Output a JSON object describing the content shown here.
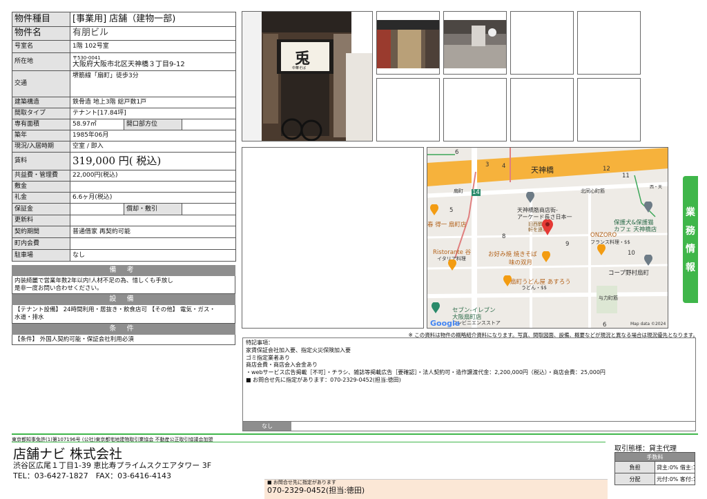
{
  "spec": {
    "type_label": "物件種目",
    "type_value": "[事業用] 店舗（建物一部)",
    "name_label": "物件名",
    "name_value": "有朋ビル",
    "room_label": "号室名",
    "room_value": "1階 102号室",
    "address_label": "所在地",
    "postal": "〒530-0041",
    "address": "大阪府大阪市北区天神橋３丁目9-12",
    "transport_label": "交通",
    "transport": "堺筋線「扇町」徒歩3分",
    "structure_label": "建築構造",
    "structure": "鉄骨造 地上3階 総戸数1戸",
    "layout_label": "間取タイプ",
    "layout": "テナント[17.84坪]",
    "area_label": "専有面積",
    "area": "58.97㎡",
    "opening_label": "開口部方位",
    "opening": "",
    "built_label": "築年",
    "built": "1985年06月",
    "status_label": "現況/入居時期",
    "status": "空室 / 即入",
    "rent_label": "賃料",
    "rent": "319,000 円( 税込)",
    "fee_label": "共益費・管理費",
    "fee": "22,000円(税込)",
    "shikikin_label": "敷金",
    "shikikin": "",
    "reikin_label": "礼金",
    "reikin": "6.6ヶ月(税込)",
    "deposit_label": "保証金",
    "deposit": "",
    "amort_label": "償却・敷引",
    "amort": "",
    "renewal_label": "更新料",
    "renewal": "",
    "contract_label": "契約期間",
    "contract": "普通借家 再契約可能",
    "town_label": "町内会費",
    "town": "",
    "parking_label": "駐車場",
    "parking": "なし"
  },
  "remarks": {
    "title": "備 考",
    "text1": "内装綺麗で営業年数2年以内!人材不足の為、惜しくも手放し",
    "text2": "是非一度お問い合わせください。"
  },
  "facilities": {
    "title": "設 備",
    "text1": "【テナント設備】 24時間利用・居抜き・飲食店可 【その他】 電気・ガス・",
    "text2": "水道・排水"
  },
  "conditions": {
    "title": "条 件",
    "text": "【条件】 外国人契約可能・保証会社利用必須"
  },
  "photos": {
    "sign_text": "兎",
    "sign_sub": "中華そば"
  },
  "map": {
    "labels": {
      "tenjinbashi": "天神橋",
      "kitaogi": "北同心町筋",
      "arcade1": "天神橋筋商店街-",
      "arcade2": "アーケード長さ日本一",
      "arcade3": "旧西鶴",
      "arcade4": "軒を連ね",
      "haruko": "春 得一 扇町店",
      "ristorante": "Ristorante 谷",
      "italian": "イタリア料理",
      "okonomi1": "お好み焼 焼きそば",
      "okonomi2": "味の双月",
      "udon1": "扇町うどん屋 あすろう",
      "udon2": "うどん・$$",
      "onzoro1": "ONZORO",
      "onzoro2": "フランス料理・$$",
      "hogo1": "保護犬&保護猫",
      "hogo2": "カフェ 天神橋店",
      "corp": "コープ野村扇町",
      "yoriki": "与力町筋",
      "seven1": "セブン-イレブン",
      "seven2": "大阪扇町店",
      "seven3": "コンビニエンスストア",
      "ogimachi": "扇町",
      "google": "Google",
      "mapdata": "Map data ©2024",
      "n6a": "6",
      "n3": "3",
      "n4": "4",
      "n12": "12",
      "n11": "11",
      "n14": "14",
      "n5": "5",
      "n8": "8",
      "n9": "9",
      "n10": "10",
      "n6b": "6",
      "nishi": "西・天"
    }
  },
  "notice": "※ この資料は物件の概略紹介資料になります。写真、間取図面、設備、概要などが現況と異なる場合は現況優先となります。",
  "special": {
    "title": "特記事項：",
    "l1": "家賃保証会社加入要、指定火災保険加入要",
    "l2": "ゴミ指定業者あり",
    "l3": "商店会費・商店会入会金あり",
    "l4": "・webサービス広告掲載［不可］・チラシ、雑誌等掲載広告［要確認］・法人契約可・造作譲渡代金：2,200,000円（税込）・商店会費：25,000円",
    "l5": "■ お問合せ先に指定があります：070-2329-0452(担当:徳田)"
  },
  "nashi": "なし",
  "side_tab": [
    "業",
    "務",
    "情",
    "報"
  ],
  "footer": {
    "license": "東京都知事免許(1)第107196号 (公社)東京都宅地建物取引業協会 不動産公正取引協議会加盟",
    "company": "店舗ナビ 株式会社",
    "address": "渋谷区広尾１丁目1-39 恵比寿プライムスクエアタワー 3F",
    "tel": "TEL：03-6427-1827　FAX：03-6416-4143",
    "contact1": "■ お問合せ先に指定があります",
    "contact2": "070-2329-0452(担当:徳田)",
    "transaction": "取引態様：貸主代理",
    "fee_title": "手数料",
    "fee_k1": "負担",
    "fee_v1": "貸主:0% 借主:100%",
    "fee_k2": "分配",
    "fee_v2": "元付:0% 客付:100%"
  },
  "colors": {
    "accent_green": "#3fb64a",
    "header_gray": "#8e8e8e",
    "label_gray": "#e3e3e3",
    "map_orange": "#f6b23c"
  }
}
